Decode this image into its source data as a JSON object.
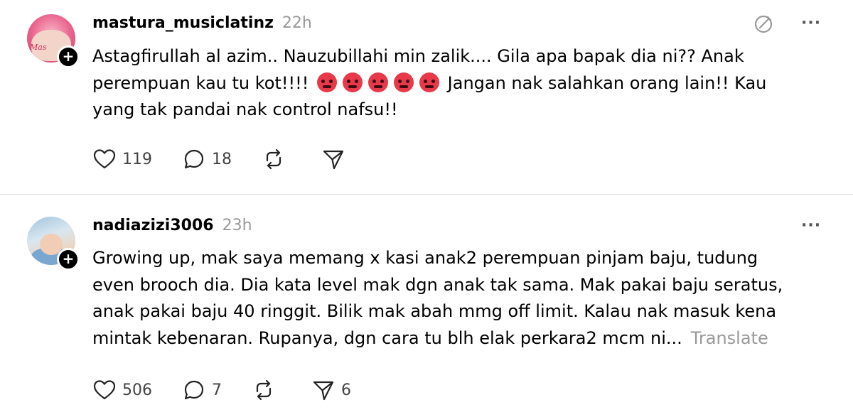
{
  "posts": [
    {
      "username": "mastura_musiclatinz",
      "time": "22h",
      "avatar_icon": "avatar-pink-portrait",
      "avatar_text": "Mas",
      "follow_symbol": "+",
      "text_before_emoji": "Astagfirullah al azim.. Nauzubillahi min zalik.... Gila apa bapak dia ni?? Anak perempuan kau tu kot!!!!",
      "emoji_name": "angry-face-emoji",
      "emoji_count": 5,
      "text_after_emoji": "Jangan nak salahkan orang lain!! Kau yang tak pandai nak control nafsu!!",
      "likes": "119",
      "comments": "18",
      "reposts": "",
      "shares": "",
      "has_edit_icon": true,
      "more_label": "···"
    },
    {
      "username": "nadiazizi3006",
      "time": "23h",
      "avatar_icon": "avatar-baby-photo",
      "follow_symbol": "+",
      "text": "Growing up, mak saya memang x kasi anak2 perempuan pinjam baju, tudung even brooch dia. Dia kata level mak dgn anak tak sama. Mak pakai baju seratus, anak pakai baju 40 ringgit. Bilik mak abah mmg off limit. Kalau nak masuk kena mintak kebenaran. Rupanya, dgn cara tu blh elak perkara2 mcm ni...",
      "translate_label": "Translate",
      "likes": "506",
      "comments": "7",
      "reposts": "",
      "shares": "6",
      "has_edit_icon": false,
      "more_label": "···"
    }
  ],
  "icons": {
    "like": "heart-icon",
    "comment": "comment-bubble-icon",
    "repost": "repost-icon",
    "share": "send-icon",
    "edit": "edit-pencil-icon",
    "more": "more-dots-icon"
  },
  "colors": {
    "text": "#000000",
    "muted": "#999999",
    "count": "#424242",
    "divider": "#dcdcdc",
    "emoji": "#e8394a"
  }
}
